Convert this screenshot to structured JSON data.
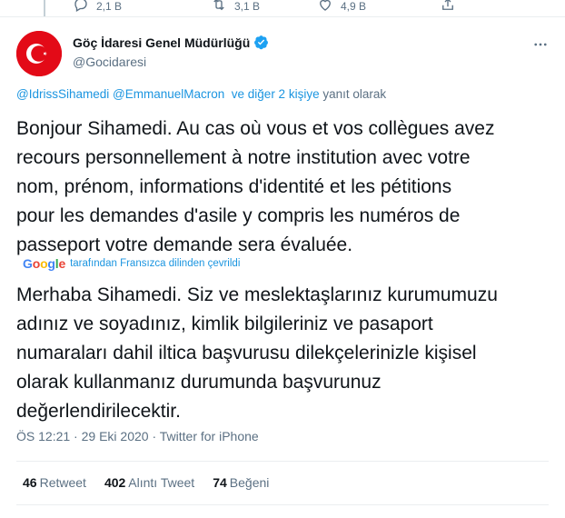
{
  "previous_tweet_actions": {
    "reply_count": "2,1 B",
    "retweet_count": "3,1 B",
    "like_count": "4,9 B"
  },
  "author": {
    "display_name": "Göç İdaresi Genel Müdürlüğü",
    "handle": "@Gocidaresi",
    "verified": true
  },
  "reply_context": {
    "mention_1": "@IdrissSihamedi",
    "mention_2": "@EmmanuelMacron",
    "others": "ve diğer 2 kişiye",
    "suffix": "yanıt olarak"
  },
  "tweet": {
    "text": "Bonjour Sihamedi. Au cas où vous et vos collègues avez\nrecours personnellement à notre institution avec votre\nnom, prénom, informations d'identité et les pétitions\npour les demandes d'asile y compris les numéros de\npasseport votre demande sera évaluée."
  },
  "translation": {
    "provider": "Google",
    "label": "tarafından Fransızca dilinden çevrildi",
    "text": "Merhaba Sihamedi. Siz ve meslektaşlarınız kurumumuzu\nadınız ve soyadınız, kimlik bilgileriniz ve pasaport\nnumaraları dahil iltica başvurusu dilekçelerinizle kişisel\nolarak kullanmanız durumunda başvurunuz\ndeğerlendirilecektir."
  },
  "meta": {
    "time": "ÖS 12:21",
    "date": "29 Eki 2020",
    "separator": "·",
    "source": "Twitter for iPhone"
  },
  "stats": {
    "retweets": "46",
    "retweets_label": "Retweet",
    "quotes": "402",
    "quotes_label": "Alıntı Tweet",
    "likes": "74",
    "likes_label": "Beğeni"
  },
  "colors": {
    "accent": "#1b95e0",
    "muted": "#5b7083",
    "avatar_bg": "#e30a17"
  }
}
